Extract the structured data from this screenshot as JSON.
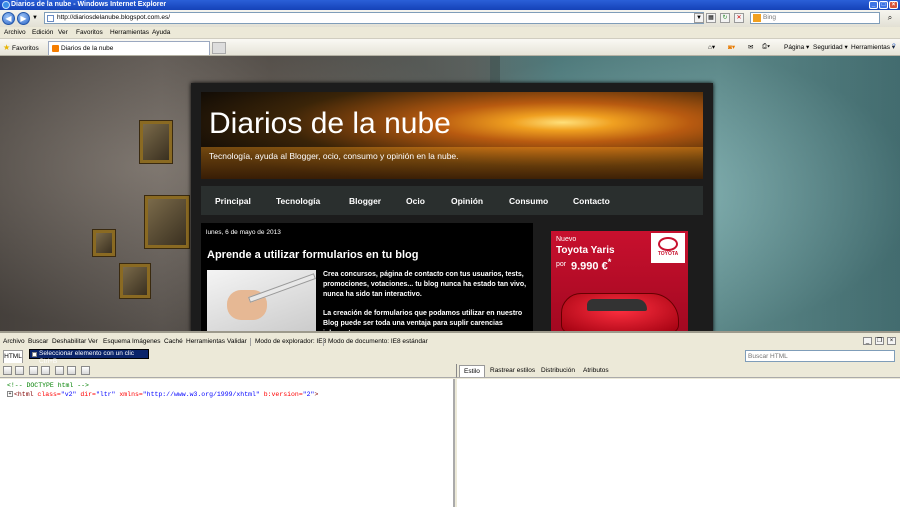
{
  "window": {
    "title": "Diarios de la nube - Windows Internet Explorer"
  },
  "address": {
    "url": "http://diariosdelanube.blogspot.com.es/",
    "search_placeholder": "Bing"
  },
  "menu": [
    "Archivo",
    "Edición",
    "Ver",
    "Favoritos",
    "Herramientas",
    "Ayuda"
  ],
  "favorites": {
    "label": "Favoritos",
    "tab_title": "Diarios de la nube"
  },
  "commandbar": {
    "page": "Página",
    "safety": "Seguridad",
    "tools": "Herramientas"
  },
  "blog": {
    "title": "Diarios de la nube",
    "description": "Tecnología, ayuda al Blogger, ocio, consumo y opinión en la nube.",
    "nav": [
      "Principal",
      "Tecnología",
      "Blogger",
      "Ocio",
      "Opinión",
      "Consumo",
      "Contacto"
    ],
    "post": {
      "date": "lunes, 6 de mayo de 2013",
      "title": "Aprende a utilizar formularios en tu blog",
      "excerpt1": "Crea concursos, página de contacto con tus usuarios, tests, promociones, votaciones... tu blog nunca ha estado tan vivo, nunca ha sido tan interactivo.",
      "excerpt2": "La creación de formularios que podamos utilizar en nuestro Blog puede ser toda una ventaja para suplir carencias inherentes a"
    },
    "ad": {
      "new": "Nuevo",
      "model": "Toyota Yaris",
      "price_label": "por",
      "price": "9.990 €",
      "price_mark": "*",
      "brand": "TOYOTA"
    }
  },
  "devtools": {
    "menu": [
      "Archivo",
      "Buscar",
      "Deshabilitar",
      "Ver",
      "Esquema",
      "Imágenes",
      "Caché",
      "Herramientas",
      "Validar"
    ],
    "browser_mode": "Modo de explorador: IE8",
    "doc_mode": "Modo de documento: IE8 estándar",
    "tab_html": "HTML",
    "tooltip": "Seleccionar elemento con un clic  Ctrl+B",
    "find_placeholder": "Buscar HTML",
    "style_tabs": [
      "Estilo",
      "Rastrear estilos",
      "Distribución",
      "Atributos"
    ],
    "dom": {
      "comment": "<!-- DOCTYPE html -->",
      "tag_open": "<html",
      "a1": "class=",
      "v1": "\"v2\"",
      "a2": "dir=",
      "v2": "\"ltr\"",
      "a3": "xmlns=",
      "v3": "\"http://www.w3.org/1999/xhtml\"",
      "a4": "b:version=",
      "v4": "\"2\"",
      "tag_close": ">"
    }
  },
  "colors": {
    "titlebar": "#1f56c8",
    "blog_bg": "#1c1c1c",
    "ad_red": "#c8102e"
  }
}
